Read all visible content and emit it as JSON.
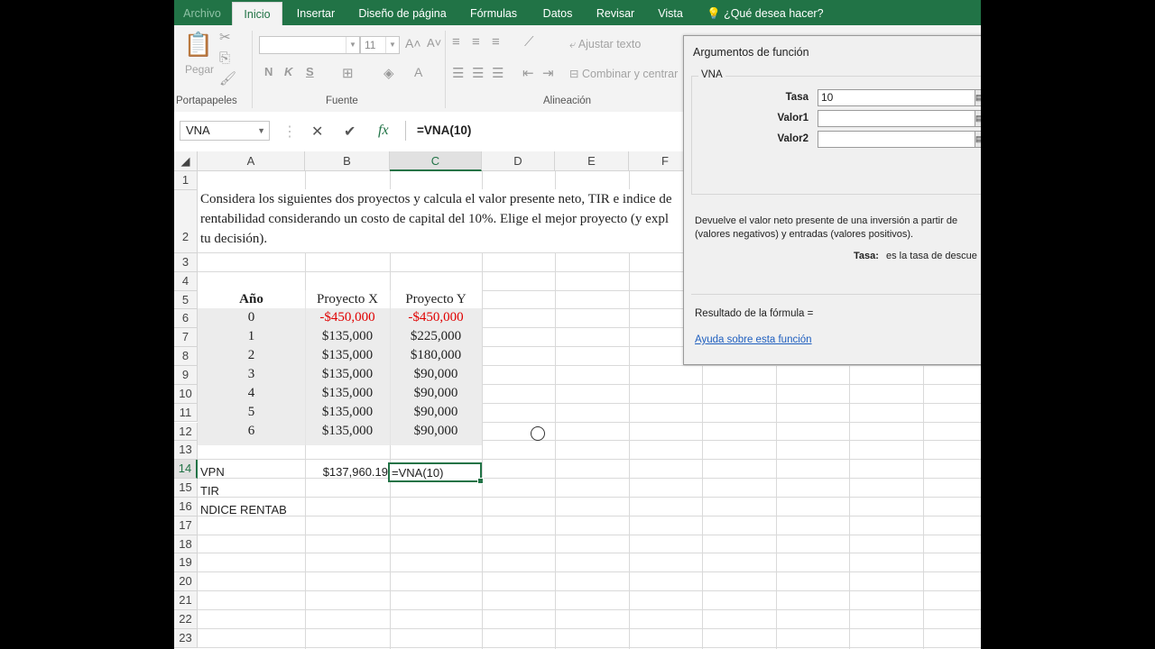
{
  "ribbon_tabs": [
    "Archivo",
    "Inicio",
    "Insertar",
    "Diseño de página",
    "Fórmulas",
    "Datos",
    "Revisar",
    "Vista"
  ],
  "tell_me": "¿Qué desea hacer?",
  "clipboard": {
    "paste_label": "Pegar",
    "group_label": "Portapapeles"
  },
  "font": {
    "size": "11",
    "group_label": "Fuente",
    "bold": "N",
    "italic": "K",
    "underline": "S"
  },
  "alignment": {
    "wrap_text": "Ajustar texto",
    "merge": "Combinar y centrar",
    "group_label": "Alineación"
  },
  "formula_bar": {
    "name_box": "VNA",
    "cancel": "✕",
    "enter": "✔",
    "fx": "fx",
    "formula": "=VNA(10)"
  },
  "columns": [
    "A",
    "B",
    "C",
    "D",
    "E",
    "F"
  ],
  "rows": [
    "1",
    "2",
    "3",
    "4",
    "5",
    "6",
    "7",
    "8",
    "9",
    "10",
    "11",
    "12",
    "13",
    "14",
    "15",
    "16",
    "17",
    "18",
    "19",
    "20",
    "21",
    "22",
    "23"
  ],
  "sheet": {
    "problem_line1": "Considera los siguientes dos proyectos y calcula el valor presente neto, TIR e indice de",
    "problem_line2": "rentabilidad  considerando un costo de capital del 10%. Elige el mejor proyecto (y expl",
    "problem_line3": "tu decisión).",
    "headers": [
      "Año",
      "Proyecto X",
      "Proyecto Y"
    ],
    "table": [
      [
        "0",
        "-$450,000",
        "-$450,000"
      ],
      [
        "1",
        "$135,000",
        "$225,000"
      ],
      [
        "2",
        "$135,000",
        "$180,000"
      ],
      [
        "3",
        "$135,000",
        "$90,000"
      ],
      [
        "4",
        "$135,000",
        "$90,000"
      ],
      [
        "5",
        "$135,000",
        "$90,000"
      ],
      [
        "6",
        "$135,000",
        "$90,000"
      ]
    ],
    "vpn_label": "VPN",
    "vpn_value": "$137,960.19",
    "active_cell_content": "=VNA(10)",
    "tir_label": "TIR",
    "indice_label": "NDICE RENTAB"
  },
  "dialog": {
    "title": "Argumentos de función",
    "function_name": "VNA",
    "args": [
      {
        "label": "Tasa",
        "value": "10"
      },
      {
        "label": "Valor1",
        "value": ""
      },
      {
        "label": "Valor2",
        "value": ""
      }
    ],
    "description_line1": "Devuelve el valor neto presente de una inversión a partir de",
    "description_line2": "(valores negativos) y entradas (valores positivos).",
    "arg_help_label": "Tasa:",
    "arg_help_text": "es la tasa de descue",
    "result_label": "Resultado de la fórmula =",
    "help_link": "Ayuda sobre esta función"
  },
  "colors": {
    "excel_green": "#217346",
    "negative": "#e00000",
    "link": "#1f5fbf"
  }
}
